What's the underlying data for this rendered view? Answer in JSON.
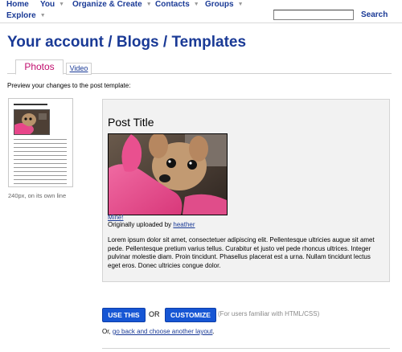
{
  "nav": {
    "items": [
      {
        "label": "Home",
        "caret": false
      },
      {
        "label": "You",
        "caret": true
      },
      {
        "label": "Organize & Create",
        "caret": true
      },
      {
        "label": "Contacts",
        "caret": true
      },
      {
        "label": "Groups",
        "caret": true
      },
      {
        "label": "Explore",
        "caret": true
      }
    ],
    "search_value": "",
    "search_button": "Search"
  },
  "breadcrumb": {
    "part1": "Your account",
    "sep": "/",
    "part2": "Blogs",
    "part3": "Templates"
  },
  "tabs": [
    {
      "label": "Photos",
      "active": true
    },
    {
      "label": "Video",
      "active": false
    }
  ],
  "preview_label": "Preview your changes to the post template:",
  "thumbnail": {
    "caption": "240px, on its own line"
  },
  "post": {
    "title": "Post Title",
    "photo_link": "Mine!",
    "credit_prefix": "Originally uploaded by",
    "credit_owner": "heather",
    "body": "Lorem ipsum dolor sit amet, consectetuer adipiscing elit. Pellentesque ultricies augue sit amet pede. Pellentesque pretium varius tellus. Curabitur et justo vel pede rhoncus ultrices. Integer pulvinar molestie diam. Proin tincidunt. Phasellus placerat est a urna. Nullam tincidunt lectus eget eros. Donec ultricies congue dolor."
  },
  "actions": {
    "use_label": "USE THIS",
    "or_label": "OR",
    "customize_label": "CUSTOMIZE",
    "customize_note": "(For users familiar with HTML/CSS)",
    "back_prefix": "Or,",
    "back_link": "go back and choose another layout",
    "back_suffix": "."
  },
  "colors": {
    "link": "#1a3a96",
    "active_tab": "#c10f6e",
    "button": "#1656d4",
    "preview_bg": "#f2f2f2"
  },
  "icons": [
    "chevron-down-icon"
  ]
}
